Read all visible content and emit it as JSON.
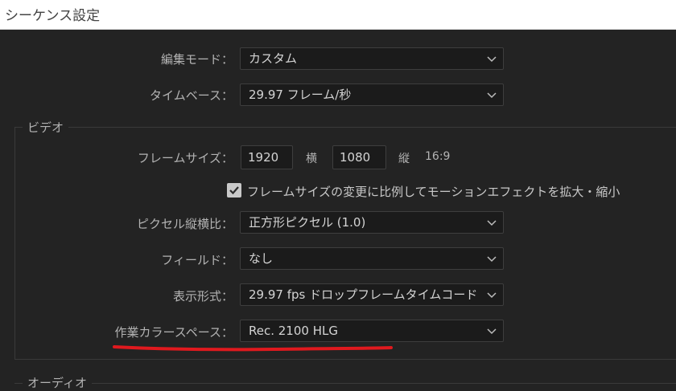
{
  "window": {
    "title": "シーケンス設定"
  },
  "editing_mode": {
    "label": "編集モード：",
    "value": "カスタム"
  },
  "timebase": {
    "label": "タイムベース：",
    "value": "29.97  フレーム/秒"
  },
  "video_section": {
    "title": "ビデオ",
    "frame_size": {
      "label": "フレームサイズ：",
      "width": "1920",
      "width_label": "横",
      "height": "1080",
      "height_label": "縦",
      "aspect": "16:9"
    },
    "scale_checkbox": {
      "checked": true,
      "label": "フレームサイズの変更に比例してモーションエフェクトを拡大・縮小"
    },
    "pixel_aspect": {
      "label": "ピクセル縦横比：",
      "value": "正方形ピクセル (1.0)"
    },
    "fields": {
      "label": "フィールド：",
      "value": "なし"
    },
    "display_format": {
      "label": "表示形式：",
      "value": "29.97  fps ドロップフレームタイムコード"
    },
    "working_color_space": {
      "label": "作業カラースペース：",
      "value": "Rec. 2100 HLG"
    }
  },
  "audio_section": {
    "title": "オーディオ"
  },
  "colors": {
    "background": "#232323",
    "annotation_underline": "#e0191e"
  },
  "icons": {
    "dropdown": "chevron-down-icon",
    "checkbox": "checkmark-icon"
  }
}
